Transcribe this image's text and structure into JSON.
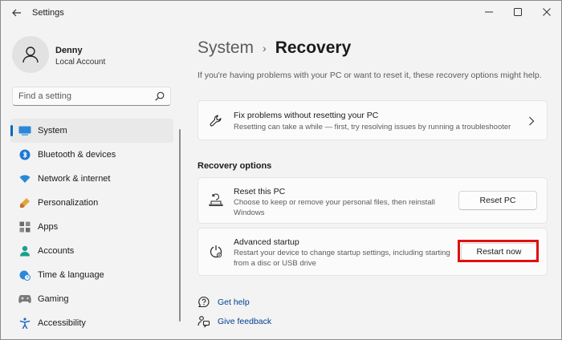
{
  "window": {
    "title": "Settings",
    "controls": {
      "minimize": "—",
      "maximize": "☐",
      "close": "✕"
    }
  },
  "user": {
    "name": "Denny",
    "account_type": "Local Account"
  },
  "search": {
    "placeholder": "Find a setting"
  },
  "sidebar": {
    "items": [
      {
        "label": "System",
        "icon": "system-icon",
        "active": true
      },
      {
        "label": "Bluetooth & devices",
        "icon": "bluetooth-icon"
      },
      {
        "label": "Network & internet",
        "icon": "wifi-icon"
      },
      {
        "label": "Personalization",
        "icon": "brush-icon"
      },
      {
        "label": "Apps",
        "icon": "apps-icon"
      },
      {
        "label": "Accounts",
        "icon": "person-icon"
      },
      {
        "label": "Time & language",
        "icon": "globe-clock-icon"
      },
      {
        "label": "Gaming",
        "icon": "gamepad-icon"
      },
      {
        "label": "Accessibility",
        "icon": "accessibility-icon"
      }
    ]
  },
  "breadcrumb": {
    "parent": "System",
    "separator": "›",
    "current": "Recovery"
  },
  "intro": "If you're having problems with your PC or want to reset it, these recovery options might help.",
  "fix_card": {
    "title": "Fix problems without resetting your PC",
    "description": "Resetting can take a while — first, try resolving issues by running a troubleshooter"
  },
  "recovery_options": {
    "heading": "Recovery options",
    "reset": {
      "title": "Reset this PC",
      "description_line1": "Choose to keep or remove your personal files, then reinstall",
      "description_line2": "Windows",
      "button": "Reset PC"
    },
    "advanced": {
      "title": "Advanced startup",
      "description_line1": "Restart your device to change startup settings, including starting",
      "description_line2": "from a disc or USB drive",
      "button": "Restart now"
    }
  },
  "links": {
    "help": "Get help",
    "feedback": "Give feedback"
  },
  "colors": {
    "accent": "#0067c0",
    "highlight": "#e01010",
    "link": "#003e92"
  }
}
